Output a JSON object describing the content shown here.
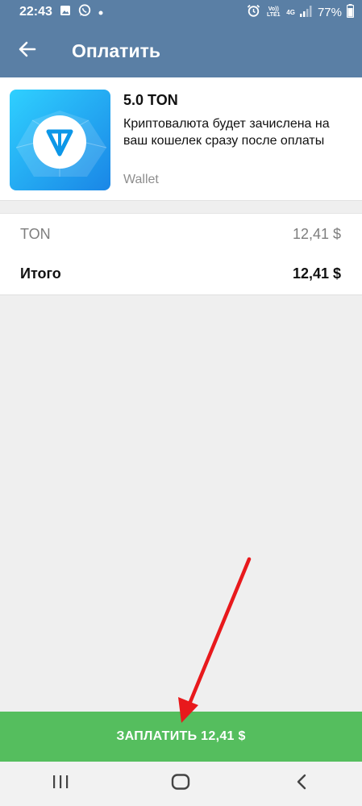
{
  "status_bar": {
    "time": "22:43",
    "volte": "Vo)) LTE1",
    "network": "4G",
    "battery": "77%",
    "icons": [
      "gallery-icon",
      "whatsapp-icon",
      "dot-icon",
      "alarm-icon",
      "signal-icon",
      "battery-icon"
    ]
  },
  "app_bar": {
    "title": "Оплатить",
    "back_icon": "arrow-left-icon"
  },
  "product": {
    "title": "5.0 TON",
    "description": "Криптовалюта будет зачислена на ваш кошелек сразу после оплаты",
    "provider": "Wallet",
    "image_icon": "ton-logo-icon"
  },
  "prices": {
    "item_label": "TON",
    "item_value": "12,41 $",
    "total_label": "Итого",
    "total_value": "12,41 $"
  },
  "pay_button": {
    "label": "ЗАПЛАТИТЬ 12,41 $"
  },
  "nav_bar": {
    "icons": [
      "recent-apps-icon",
      "home-icon",
      "back-icon"
    ]
  },
  "colors": {
    "app_bar": "#5a7fa5",
    "pay_button": "#55be5e",
    "annotation_arrow": "#e8191c"
  }
}
